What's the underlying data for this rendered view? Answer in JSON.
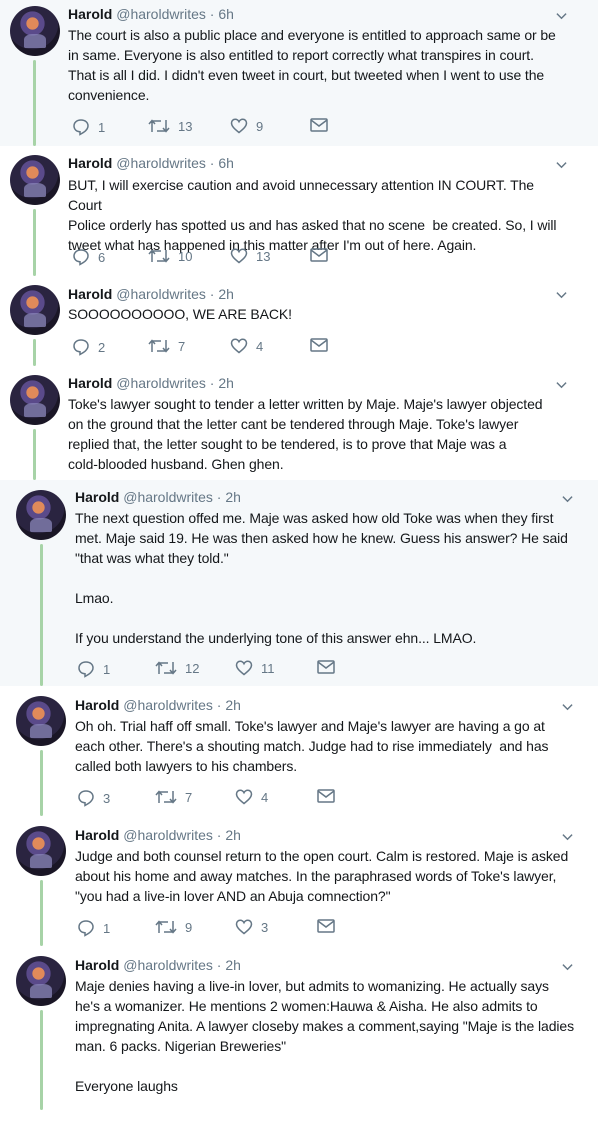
{
  "tweets": [
    {
      "name": "Harold",
      "handle": "@haroldwrites · 6h",
      "text": "The court is also a public place and everyone is entitled to approach same or be\nin same. Everyone is also entitled to report correctly what transpires in court.\nThat is all I did. I didn't even tweet in court, but tweeted when I went to use the\nconvenience.",
      "replies": "1",
      "retweets": "13",
      "likes": "9"
    },
    {
      "name": "Harold",
      "handle": "@haroldwrites · 6h",
      "text": "BUT, I will exercise caution and avoid unnecessary attention IN COURT. The Court\nPolice orderly has spotted us and has asked that no scene  be created. So, I will\ntweet what has happened in this matter after I'm out of here. Again.",
      "replies": "6",
      "retweets": "10",
      "likes": "13"
    },
    {
      "name": "Harold",
      "handle": "@haroldwrites · 2h",
      "text": "SOOOOOOOOOO, WE ARE BACK!",
      "replies": "2",
      "retweets": "7",
      "likes": "4"
    },
    {
      "name": "Harold",
      "handle": "@haroldwrites · 2h",
      "text": "Toke's lawyer sought to tender a letter written by Maje. Maje's lawyer objected\non the ground that the letter cant be tendered through Maje. Toke's lawyer\nreplied that, the letter sought to be tendered, is to prove that Maje was a\ncold-blooded husband. Ghen ghen.",
      "replies": "",
      "retweets": "",
      "likes": ""
    },
    {
      "name": "Harold",
      "handle": "@haroldwrites · 2h",
      "text": "The next question offed me. Maje was asked how old Toke was when they first\nmet. Maje said 19. He was then asked how he knew. Guess his answer? He said\n\"that was what they told.\"\n\nLmao.\n\nIf you understand the underlying tone of this answer ehn... LMAO.",
      "replies": "1",
      "retweets": "12",
      "likes": "11"
    },
    {
      "name": "Harold",
      "handle": "@haroldwrites · 2h",
      "text": "Oh oh. Trial haff off small. Toke's lawyer and Maje's lawyer are having a go at\neach other. There's a shouting match. Judge had to rise immediately  and has\ncalled both lawyers to his chambers.",
      "replies": "3",
      "retweets": "7",
      "likes": "4"
    },
    {
      "name": "Harold",
      "handle": "@haroldwrites · 2h",
      "text": "Judge and both counsel return to the open court. Calm is restored. Maje is asked\nabout his home and away matches. In the paraphrased words of Toke's lawyer,\n\"you had a live-in lover AND an Abuja comnection?\"",
      "replies": "1",
      "retweets": "9",
      "likes": "3"
    },
    {
      "name": "Harold",
      "handle": "@haroldwrites · 2h",
      "text": "Maje denies having a live-in lover, but admits to womanizing. He actually says\nhe's a womanizer. He mentions 2 women:Hauwa & Aisha. He also admits to\nimpregnating Anita. A lawyer closeby makes a comment,saying \"Maje is the ladies\nman. 6 packs. Nigerian Breweries\"\n\nEveryone laughs",
      "replies": "",
      "retweets": "",
      "likes": ""
    }
  ]
}
